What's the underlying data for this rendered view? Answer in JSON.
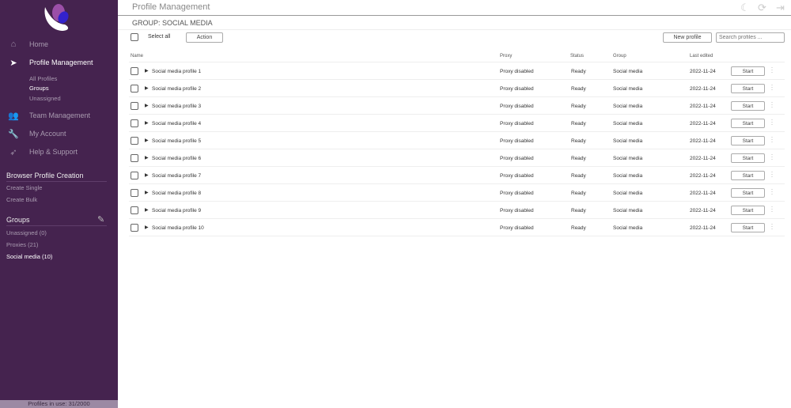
{
  "sidebar": {
    "nav": [
      {
        "label": "Home",
        "icon": "home-icon"
      },
      {
        "label": "Profile Management",
        "icon": "cursor-icon"
      },
      {
        "label": "Team Management",
        "icon": "users-icon"
      },
      {
        "label": "My Account",
        "icon": "wrench-icon"
      },
      {
        "label": "Help & Support",
        "icon": "send-icon"
      }
    ],
    "sub": [
      "All Profiles",
      "Groups",
      "Unassigned"
    ],
    "creation": {
      "title": "Browser Profile Creation",
      "links": [
        "Create Single",
        "Create Bulk"
      ]
    },
    "groups": {
      "title": "Groups",
      "items": [
        "Unassigned (0)",
        "Proxies (21)",
        "Social media (10)"
      ]
    },
    "footer": "Profiles in use:  31/2000"
  },
  "header": {
    "title": "Profile Management",
    "group_title": "GROUP: SOCIAL MEDIA"
  },
  "toolbar": {
    "select_all": "Select all",
    "action": "Action",
    "new_profile": "New profile",
    "search_placeholder": "Search profiles ..."
  },
  "table": {
    "headers": [
      "Name",
      "Proxy",
      "Status",
      "Group",
      "Last edited"
    ],
    "start_label": "Start",
    "rows": [
      {
        "name": "Social media profile 1",
        "proxy": "Proxy disabled",
        "status": "Ready",
        "group": "Social media",
        "edited": "2022-11-24"
      },
      {
        "name": "Social media profile 2",
        "proxy": "Proxy disabled",
        "status": "Ready",
        "group": "Social media",
        "edited": "2022-11-24"
      },
      {
        "name": "Social media profile 3",
        "proxy": "Proxy disabled",
        "status": "Ready",
        "group": "Social media",
        "edited": "2022-11-24"
      },
      {
        "name": "Social media profile 4",
        "proxy": "Proxy disabled",
        "status": "Ready",
        "group": "Social media",
        "edited": "2022-11-24"
      },
      {
        "name": "Social media profile 5",
        "proxy": "Proxy disabled",
        "status": "Ready",
        "group": "Social media",
        "edited": "2022-11-24"
      },
      {
        "name": "Social media profile 6",
        "proxy": "Proxy disabled",
        "status": "Ready",
        "group": "Social media",
        "edited": "2022-11-24"
      },
      {
        "name": "Social media profile 7",
        "proxy": "Proxy disabled",
        "status": "Ready",
        "group": "Social media",
        "edited": "2022-11-24"
      },
      {
        "name": "Social media profile 8",
        "proxy": "Proxy disabled",
        "status": "Ready",
        "group": "Social media",
        "edited": "2022-11-24"
      },
      {
        "name": "Social media profile 9",
        "proxy": "Proxy disabled",
        "status": "Ready",
        "group": "Social media",
        "edited": "2022-11-24"
      },
      {
        "name": "Social media profile 10",
        "proxy": "Proxy disabled",
        "status": "Ready",
        "group": "Social media",
        "edited": "2022-11-24"
      }
    ]
  }
}
